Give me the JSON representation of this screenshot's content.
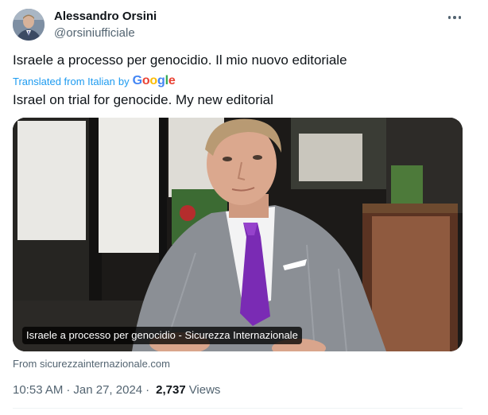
{
  "author": {
    "display_name": "Alessandro Orsini",
    "handle": "@orsiniufficiale"
  },
  "tweet": {
    "text": "Israele a processo per genocidio. Il mio nuovo editoriale",
    "translated_from": "Translated from Italian",
    "translated_by": "by",
    "translator_logo": "Google",
    "translated_text": "Israel on trial for genocide. My new editorial"
  },
  "card": {
    "caption": "Israele a processo per genocidio - Sicurezza Internazionale",
    "source": "From sicurezzainternazionale.com"
  },
  "meta": {
    "time": "10:53 AM",
    "separator": "·",
    "date": "Jan 27, 2024",
    "views_count": "2,737",
    "views_label": "Views"
  },
  "icons": {
    "more": "more-horizontal-icon"
  },
  "colors": {
    "link_blue": "#1d9bf0",
    "secondary_text": "#536471",
    "primary_text": "#0f1419"
  }
}
